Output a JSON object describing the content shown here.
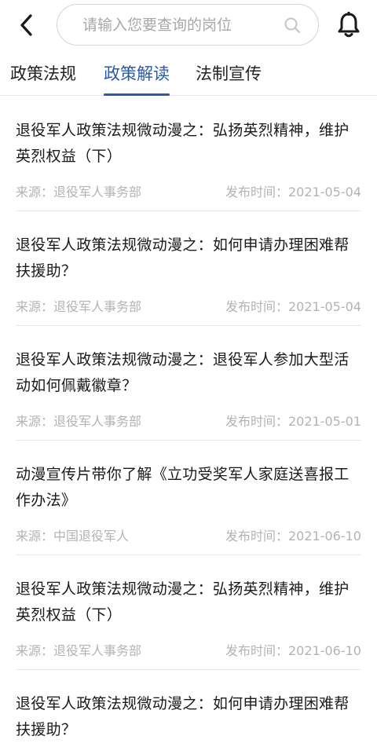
{
  "header": {
    "back_icon": "chevron-left-icon",
    "search_placeholder": "请输入您要查询的岗位",
    "search_value": "",
    "search_icon": "search-icon",
    "bell_icon": "bell-icon"
  },
  "tabs": [
    {
      "label": "政策法规",
      "active": false
    },
    {
      "label": "政策解读",
      "active": true
    },
    {
      "label": "法制宣传",
      "active": false
    }
  ],
  "colors": {
    "accent": "#2a5aa8",
    "meta_text": "#b3b3b3",
    "divider": "#e8e8e8"
  },
  "articles": [
    {
      "title": "退役军人政策法规微动漫之：弘扬英烈精神，维护英烈权益（下）",
      "source": "来源：退役军人事务部",
      "date": "发布时间：2021-05-04"
    },
    {
      "title": "退役军人政策法规微动漫之：如何申请办理困难帮扶援助？",
      "source": "来源：退役军人事务部",
      "date": "发布时间：2021-05-04"
    },
    {
      "title": "退役军人政策法规微动漫之：退役军人参加大型活动如何佩戴徽章？",
      "source": "来源：退役军人事务部",
      "date": "发布时间：2021-05-01"
    },
    {
      "title": "动漫宣传片带你了解《立功受奖军人家庭送喜报工作办法》",
      "source": "来源：中国退役军人",
      "date": "发布时间：2021-06-10"
    },
    {
      "title": "退役军人政策法规微动漫之：弘扬英烈精神，维护英烈权益（下）",
      "source": "来源：退役军人事务部",
      "date": "发布时间：2021-06-10"
    },
    {
      "title": "退役军人政策法规微动漫之：如何申请办理困难帮扶援助？",
      "source": "",
      "date": ""
    }
  ]
}
